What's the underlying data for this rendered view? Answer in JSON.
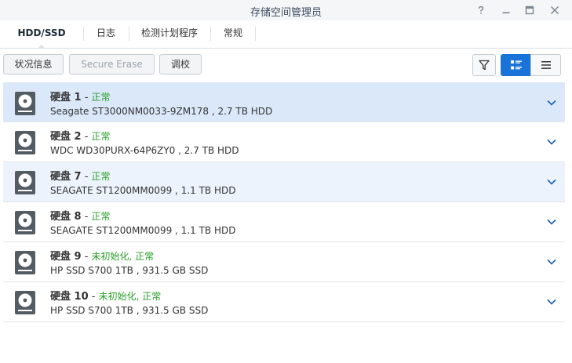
{
  "window": {
    "title": "存储空间管理员"
  },
  "tabs": [
    {
      "label": "HDD/SSD"
    },
    {
      "label": "日志"
    },
    {
      "label": "检测计划程序"
    },
    {
      "label": "常规"
    }
  ],
  "toolbar": {
    "info_label": "状况信息",
    "erase_label": "Secure Erase",
    "calibrate_label": "调校"
  },
  "disks": [
    {
      "name": "硬盘 1",
      "status": "正常",
      "detail": "Seagate ST3000NM0033-9ZM178 , 2.7 TB HDD"
    },
    {
      "name": "硬盘 2",
      "status": "正常",
      "detail": "WDC WD30PURX-64P6ZY0 , 2.7 TB HDD"
    },
    {
      "name": "硬盘 7",
      "status": "正常",
      "detail": "SEAGATE ST1200MM0099 , 1.1 TB HDD"
    },
    {
      "name": "硬盘 8",
      "status": "正常",
      "detail": "SEAGATE ST1200MM0099 , 1.1 TB HDD"
    },
    {
      "name": "硬盘 9",
      "status": "未初始化, 正常",
      "detail": "HP SSD S700 1TB , 931.5 GB SSD"
    },
    {
      "name": "硬盘 10",
      "status": "未初始化, 正常",
      "detail": "HP SSD S700 1TB , 931.5 GB SSD"
    }
  ],
  "colors": {
    "accent": "#1a73d8",
    "status_ok": "#2aa02a",
    "selected_row": "#dbe8fa"
  }
}
